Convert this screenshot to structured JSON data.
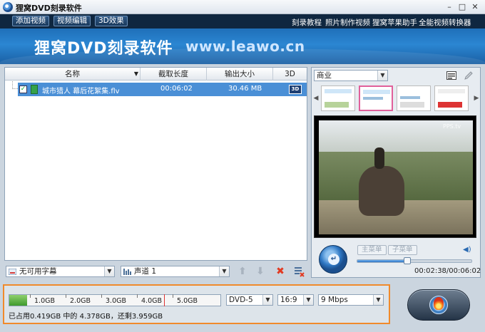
{
  "window": {
    "title": "狸窝DVD刻录软件",
    "controls": {
      "minimize": "–",
      "maximize": "□",
      "close": "✕"
    }
  },
  "menubar": {
    "tabs": [
      "添加视频",
      "视频编辑",
      "3D效果"
    ],
    "links": [
      "刻录教程",
      "照片制作视频",
      "狸窝苹果助手",
      "全能视频转换器"
    ]
  },
  "banner": {
    "brand": "狸窝DVD刻录软件",
    "url": "www.leawo.cn"
  },
  "list": {
    "columns": [
      "名称",
      "截取长度",
      "输出大小",
      "3D"
    ],
    "rows": [
      {
        "name": "城市猎人 幕后花絮集.flv",
        "duration": "00:06:02",
        "size": "30.46 MB",
        "badge": "3D"
      }
    ],
    "subtitle": "无可用字幕",
    "audio": "声道 1"
  },
  "preview": {
    "menu_template": "商业",
    "main_menu": "主菜单",
    "sub_menu": "子菜单",
    "timecode": "00:02:38/00:06:02",
    "progress": 0.44,
    "watermark": "PPS.tv"
  },
  "disc": {
    "ticks": [
      "1.0GB",
      "2.0GB",
      "3.0GB",
      "4.0GB",
      "5.0GB"
    ],
    "used_fraction": 0.083,
    "limit_fraction": 0.73,
    "status": "已占用0.419GB 中的 4.378GB，还剩3.959GB",
    "type": "DVD-5",
    "aspect": "16:9",
    "bitrate": "9 Mbps"
  },
  "colors": {
    "accent": "#f08a2b",
    "selection": "#4a8fd6",
    "menubar": "#0f2740"
  }
}
